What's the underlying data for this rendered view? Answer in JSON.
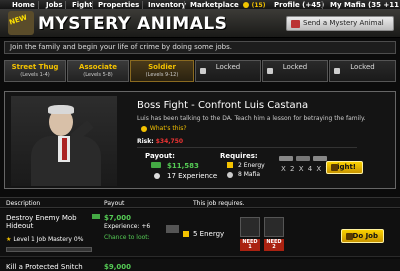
{
  "nav": {
    "items": [
      "Home",
      "Jobs",
      "Fight",
      "Properties",
      "Inventory",
      "Marketplace"
    ],
    "marketplace_count": "(15)",
    "profile": "Profile (+45)",
    "mafia": "My Mafia (35 +11"
  },
  "banner": {
    "new_label": "NEW",
    "title": "MYSTERY ANIMALS",
    "send_button": "Send a Mystery Animal"
  },
  "info_bar": "Join the family and begin your life of crime by doing some jobs.",
  "tabs": [
    {
      "title": "Street Thug",
      "levels": "(Levels 1-4)",
      "state": "open"
    },
    {
      "title": "Associate",
      "levels": "(Levels 5-8)",
      "state": "open"
    },
    {
      "title": "Soldier",
      "levels": "(Levels 9-12)",
      "state": "active"
    },
    {
      "title": "Locked",
      "levels": "",
      "state": "locked"
    },
    {
      "title": "Locked",
      "levels": "",
      "state": "locked"
    },
    {
      "title": "Locked",
      "levels": "",
      "state": "locked"
    }
  ],
  "boss": {
    "title": "Boss Fight - Confront Luis Castana",
    "description": "Luis has been talking to the DA. Teach him a lesson for betraying the family.",
    "whats_this": "What's this?",
    "risk_label": "Risk:",
    "risk_value": "$34,750",
    "payout_header": "Payout:",
    "payout_cash": "$11,583",
    "payout_exp": "17 Experience",
    "requires_header": "Requires:",
    "req_energy": "2 Energy",
    "req_mafia": "8 Mafia",
    "multipliers": "X 2  X 4  X 2",
    "fight_button": "Fight!"
  },
  "table": {
    "headers": [
      "Description",
      "Payout",
      "This job requires."
    ],
    "rows": [
      {
        "name": "Destroy Enemy Mob Hideout",
        "mastery": "Level 1 Job Mastery 0%",
        "mastery_progress": 0.0,
        "cash": "$7,000",
        "experience": "Experience: +6",
        "loot": "Chance to loot:",
        "energy": "5 Energy",
        "need_labels": [
          "NEED",
          "NEED"
        ],
        "need_counts": [
          "1",
          "2"
        ],
        "button": "Do Job"
      },
      {
        "name": "Kill a Protected Snitch",
        "cash": "$9,000"
      }
    ]
  }
}
